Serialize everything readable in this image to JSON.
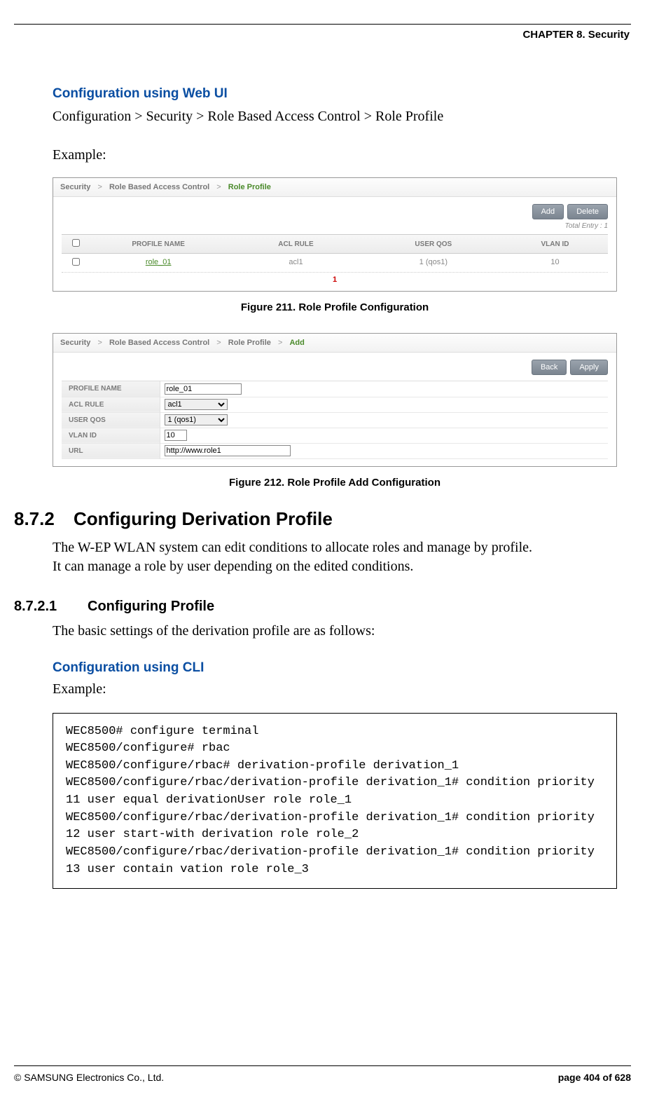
{
  "chapter_header": "CHAPTER 8. Security",
  "sec_web_ui_title": "Configuration using Web UI",
  "breadcrumb_text": "Configuration > Security > Role Based Access Control > Role Profile",
  "example_label": "Example:",
  "screenshot1": {
    "crumb1": "Security",
    "crumb2": "Role Based Access Control",
    "crumb3": "Role Profile",
    "btn_add": "Add",
    "btn_delete": "Delete",
    "total_entry": "Total Entry : 1",
    "th_profile": "PROFILE NAME",
    "th_acl": "ACL RULE",
    "th_qos": "USER QOS",
    "th_vlan": "VLAN ID",
    "row": {
      "profile": "role_01",
      "acl": "acl1",
      "qos": "1 (qos1)",
      "vlan": "10"
    },
    "pager": "1"
  },
  "fig211_caption": "Figure 211. Role Profile Configuration",
  "screenshot2": {
    "crumb1": "Security",
    "crumb2": "Role Based Access Control",
    "crumb3": "Role Profile",
    "crumb4": "Add",
    "btn_back": "Back",
    "btn_apply": "Apply",
    "lbl_profile": "PROFILE NAME",
    "lbl_acl": "ACL RULE",
    "lbl_qos": "USER QOS",
    "lbl_vlan": "VLAN ID",
    "lbl_url": "URL",
    "val_profile": "role_01",
    "val_acl": "acl1",
    "val_qos": "1 (qos1)",
    "val_vlan": "10",
    "val_url": "http://www.role1"
  },
  "fig212_caption": "Figure 212. Role Profile Add Configuration",
  "sec_num_872": "8.7.2",
  "sec_title_872": "Configuring Derivation Profile",
  "para_872_1": "The W-EP WLAN system can edit conditions to allocate roles and manage by profile.",
  "para_872_2": "It can manage a role by user depending on the edited conditions.",
  "sub_num_8721": "8.7.2.1",
  "sub_title_8721": "Configuring Profile",
  "para_8721": "The basic settings of the derivation profile are as follows:",
  "cli_heading": "Configuration using CLI",
  "cli_example_label": "Example:",
  "cli_code": "WEC8500# configure terminal\nWEC8500/configure# rbac\nWEC8500/configure/rbac# derivation-profile derivation_1\nWEC8500/configure/rbac/derivation-profile derivation_1# condition priority 11 user equal derivationUser role role_1\nWEC8500/configure/rbac/derivation-profile derivation_1# condition priority 12 user start-with derivation role role_2\nWEC8500/configure/rbac/derivation-profile derivation_1# condition priority 13 user contain vation role role_3",
  "footer_left": "© SAMSUNG Electronics Co., Ltd.",
  "footer_right": "page 404 of 628"
}
